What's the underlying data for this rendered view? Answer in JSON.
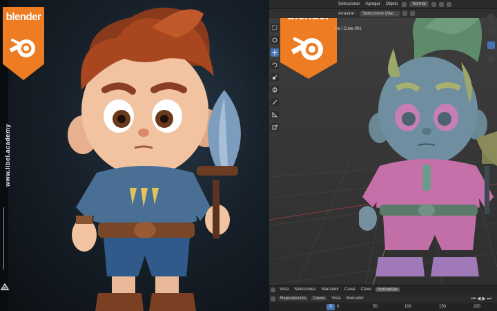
{
  "brand": {
    "badge_text": "blender",
    "vertical_text": "www.libel.academy",
    "accent_color": "#ee7c22"
  },
  "viewport_header": {
    "menu": [
      "Seleccionar",
      "Agregar",
      "Objeto"
    ],
    "orientation_value": "Normal",
    "drag_label": "Arrastrar:",
    "drag_value": "Seleccionar (Mar..."
  },
  "collection_label": "na | Cube.001",
  "toolbar_icons": [
    "select-box-icon",
    "cursor-icon",
    "move-icon",
    "rotate-icon",
    "scale-icon",
    "transform-icon",
    "annotate-icon",
    "measure-icon",
    "add-cube-icon"
  ],
  "timeline": {
    "menu": [
      "Vista",
      "Seleccionar",
      "Marcador",
      "Canal",
      "Clave"
    ],
    "normalize_label": "Normalizar",
    "playback_menu": [
      "Reproducción",
      "Claves",
      "Vista",
      "Marcador"
    ],
    "current_frame": "0",
    "frame_ticks": [
      "0",
      "50",
      "100",
      "150",
      "200"
    ]
  }
}
